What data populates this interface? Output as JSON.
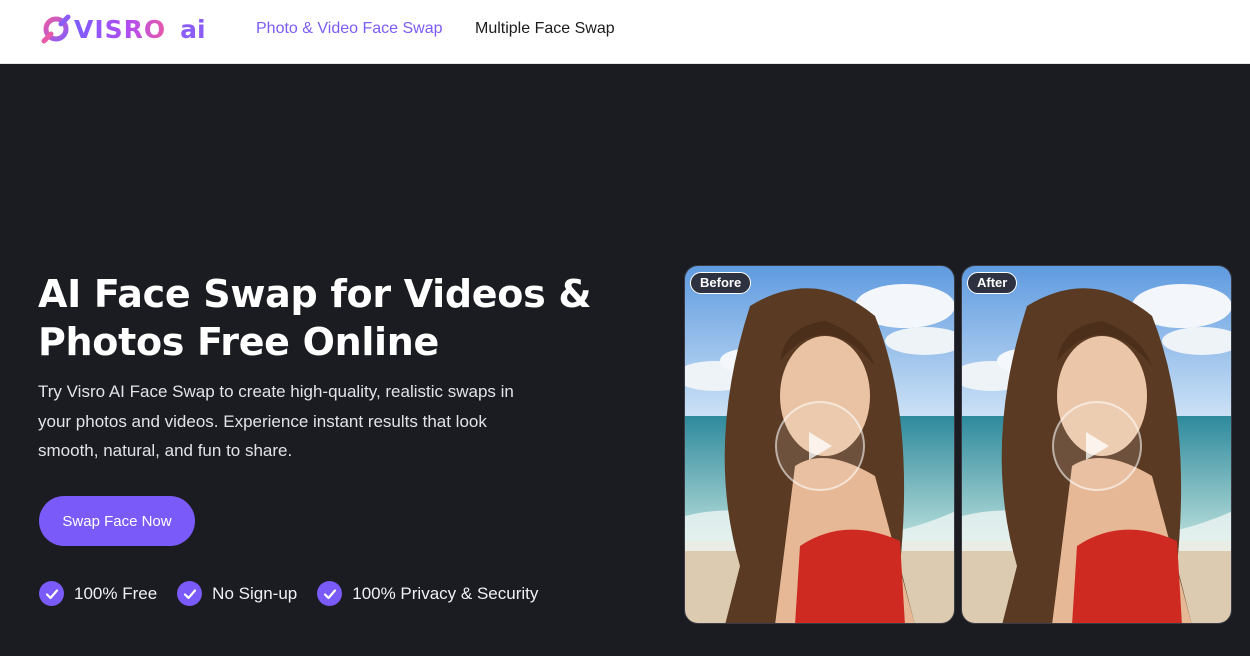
{
  "brand": {
    "name": "VISRO",
    "suffix": "ai",
    "colors": {
      "accent": "#7a5af8",
      "nav_active": "#7b5cf5",
      "background": "#1b1c22"
    }
  },
  "nav": {
    "links": [
      {
        "label": "Photo & Video Face Swap",
        "active": true
      },
      {
        "label": "Multiple Face Swap",
        "active": false
      }
    ]
  },
  "hero": {
    "title": "AI Face Swap for Videos & Photos Free Online",
    "description": "Try Visro AI Face Swap to create high-quality, realistic swaps in your photos and videos. Experience instant results that look smooth, natural, and fun to share.",
    "cta_label": "Swap Face Now",
    "features": [
      {
        "label": "100% Free",
        "icon": "check-icon"
      },
      {
        "label": "No Sign-up",
        "icon": "check-icon"
      },
      {
        "label": "100% Privacy & Security",
        "icon": "check-icon"
      }
    ]
  },
  "preview": {
    "before_label": "Before",
    "after_label": "After",
    "play_icon": "play-icon"
  }
}
